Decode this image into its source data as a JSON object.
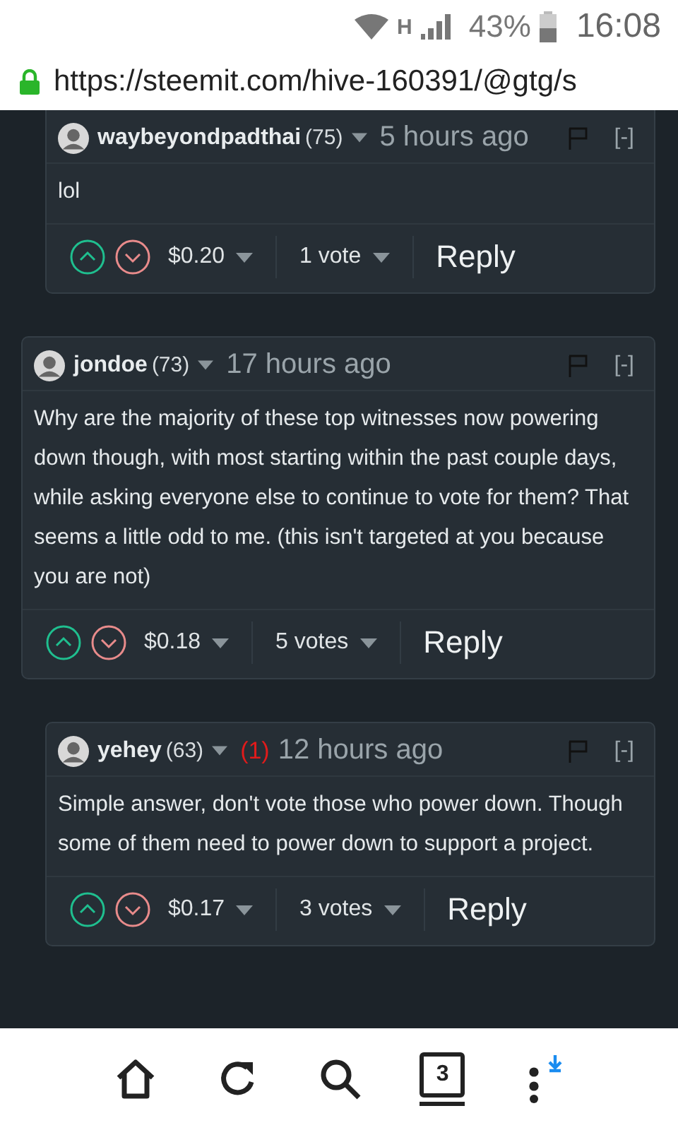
{
  "status_bar": {
    "network": "H",
    "battery": "43%",
    "time": "16:08"
  },
  "address_bar": {
    "url": "https://steemit.com/hive-160391/@gtg/s"
  },
  "comments": [
    {
      "nested": true,
      "author": "waybeyondpadthai",
      "reputation": "(75)",
      "time": "5 hours ago",
      "collapse": "[-]",
      "body": "lol",
      "payout": "$0.20",
      "votes": "1 vote",
      "reply": "Reply"
    },
    {
      "nested": false,
      "author": "jondoe",
      "reputation": "(73)",
      "time": "17 hours ago",
      "collapse": "[-]",
      "body": "Why are the majority of these top witnesses now powering down though, with most starting within the past couple days, while asking everyone else to continue to vote for them? That seems a little odd to me. (this isn't targeted at you because you are not)",
      "payout": "$0.18",
      "votes": "5 votes",
      "reply": "Reply"
    },
    {
      "nested": true,
      "author": "yehey",
      "reputation": "(63)",
      "flags": "(1)",
      "time": "12 hours ago",
      "collapse": "[-]",
      "body": "Simple answer, don't vote those who power down. Though some of them need to power down to support a project.",
      "payout": "$0.17",
      "votes": "3 votes",
      "reply": "Reply"
    }
  ],
  "bottom_nav": {
    "tab_count": "3"
  }
}
